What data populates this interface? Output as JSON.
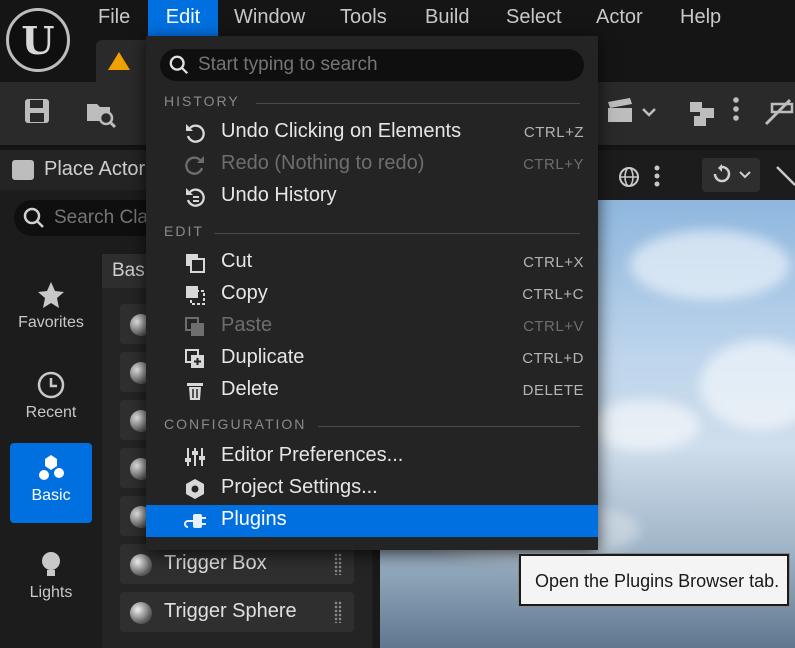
{
  "menubar": {
    "items": [
      {
        "label": "File"
      },
      {
        "label": "Edit"
      },
      {
        "label": "Window"
      },
      {
        "label": "Tools"
      },
      {
        "label": "Build"
      },
      {
        "label": "Select"
      },
      {
        "label": "Actor"
      },
      {
        "label": "Help"
      }
    ],
    "active_item": "Edit",
    "logo_glyph": "U"
  },
  "edit_menu": {
    "search_placeholder": "Start typing to search",
    "sections": [
      {
        "title": "HISTORY",
        "items": [
          {
            "label": "Undo Clicking on Elements",
            "shortcut": "CTRL+Z",
            "icon": "undo-icon",
            "enabled": true
          },
          {
            "label": "Redo (Nothing to redo)",
            "shortcut": "CTRL+Y",
            "icon": "redo-icon",
            "enabled": false
          },
          {
            "label": "Undo History",
            "shortcut": "",
            "icon": "undo-history-icon",
            "enabled": true
          }
        ]
      },
      {
        "title": "EDIT",
        "items": [
          {
            "label": "Cut",
            "shortcut": "CTRL+X",
            "icon": "cut-icon",
            "enabled": true
          },
          {
            "label": "Copy",
            "shortcut": "CTRL+C",
            "icon": "copy-icon",
            "enabled": true
          },
          {
            "label": "Paste",
            "shortcut": "CTRL+V",
            "icon": "paste-icon",
            "enabled": false
          },
          {
            "label": "Duplicate",
            "shortcut": "CTRL+D",
            "icon": "duplicate-icon",
            "enabled": true
          },
          {
            "label": "Delete",
            "shortcut": "DELETE",
            "icon": "trash-icon",
            "enabled": true
          }
        ]
      },
      {
        "title": "CONFIGURATION",
        "items": [
          {
            "label": "Editor Preferences...",
            "shortcut": "",
            "icon": "sliders-icon",
            "enabled": true
          },
          {
            "label": "Project Settings...",
            "shortcut": "",
            "icon": "settings-cube-icon",
            "enabled": true
          },
          {
            "label": "Plugins",
            "shortcut": "",
            "icon": "plug-icon",
            "enabled": true,
            "highlighted": true
          }
        ]
      }
    ]
  },
  "tooltip": {
    "text": "Open the Plugins Browser tab."
  },
  "place_actors": {
    "title": "Place Actor",
    "search_placeholder": "Search Cla",
    "categories": [
      {
        "label": "Favorites",
        "icon": "star-icon"
      },
      {
        "label": "Recent",
        "icon": "clock-icon"
      },
      {
        "label": "Basic",
        "icon": "basic-shapes-icon",
        "selected": true
      },
      {
        "label": "Lights",
        "icon": "lightbulb-icon"
      }
    ],
    "list_header": "Bas",
    "actors": [
      {
        "name": "Trigger Box"
      },
      {
        "name": "Trigger Sphere"
      }
    ]
  },
  "colors": {
    "accent": "#0070e0",
    "menu_bg": "#242424",
    "app_bg": "#151515",
    "warning": "#f0a000"
  }
}
